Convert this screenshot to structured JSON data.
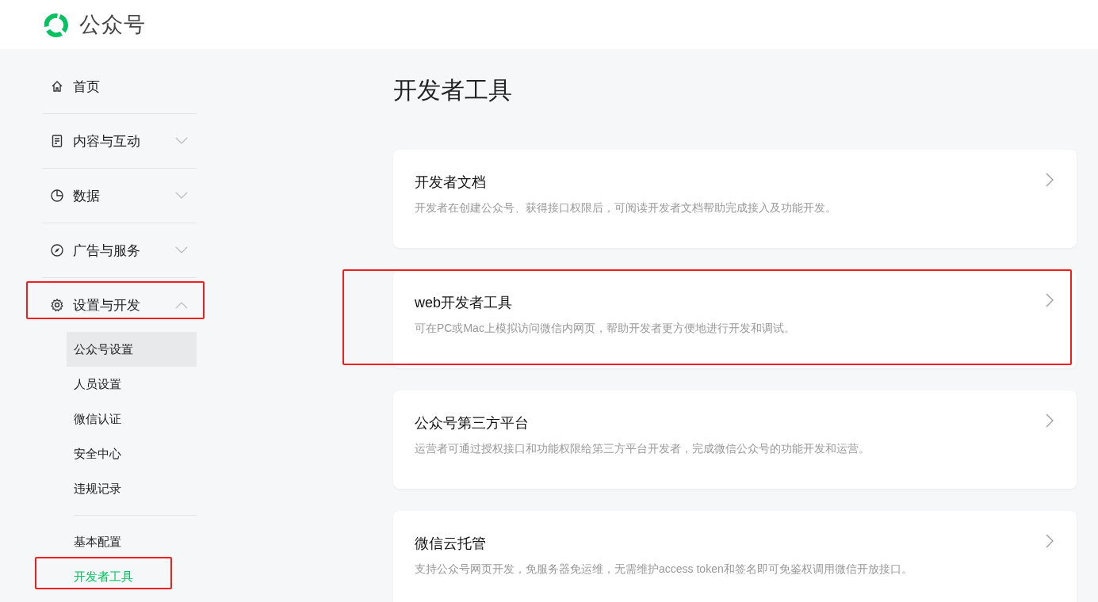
{
  "header": {
    "logo_text": "公众号"
  },
  "sidebar": {
    "items": [
      {
        "label": "首页",
        "kind": "link",
        "highlighted": false
      },
      {
        "label": "内容与互动",
        "kind": "menu",
        "expanded": false,
        "highlighted": false
      },
      {
        "label": "数据",
        "kind": "menu",
        "expanded": false,
        "highlighted": false
      },
      {
        "label": "广告与服务",
        "kind": "menu",
        "expanded": false,
        "highlighted": false
      },
      {
        "label": "设置与开发",
        "kind": "menu",
        "expanded": true,
        "highlighted": true,
        "groups": [
          [
            {
              "label": "公众号设置",
              "selected": false,
              "hovered": true,
              "highlighted": false
            },
            {
              "label": "人员设置",
              "selected": false,
              "hovered": false,
              "highlighted": false
            },
            {
              "label": "微信认证",
              "selected": false,
              "hovered": false,
              "highlighted": false
            },
            {
              "label": "安全中心",
              "selected": false,
              "hovered": false,
              "highlighted": false
            },
            {
              "label": "违规记录",
              "selected": false,
              "hovered": false,
              "highlighted": false
            }
          ],
          [
            {
              "label": "基本配置",
              "selected": false,
              "hovered": false,
              "highlighted": false
            },
            {
              "label": "开发者工具",
              "selected": true,
              "hovered": false,
              "highlighted": true
            }
          ]
        ]
      }
    ]
  },
  "main": {
    "title": "开发者工具",
    "cards": [
      {
        "title": "开发者文档",
        "description": "开发者在创建公众号、获得接口权限后，可阅读开发者文档帮助完成接入及功能开发。",
        "highlighted": false
      },
      {
        "title": "web开发者工具",
        "description": "可在PC或Mac上模拟访问微信内网页，帮助开发者更方便地进行开发和调试。",
        "highlighted": true
      },
      {
        "title": "公众号第三方平台",
        "description": "运营者可通过授权接口和功能权限给第三方平台开发者，完成微信公众号的功能开发和运营。",
        "highlighted": false
      },
      {
        "title": "微信云托管",
        "description": "支持公众号网页开发，免服务器免运维，无需维护access token和签名即可免鉴权调用微信开放接口。",
        "highlighted": false
      }
    ]
  }
}
